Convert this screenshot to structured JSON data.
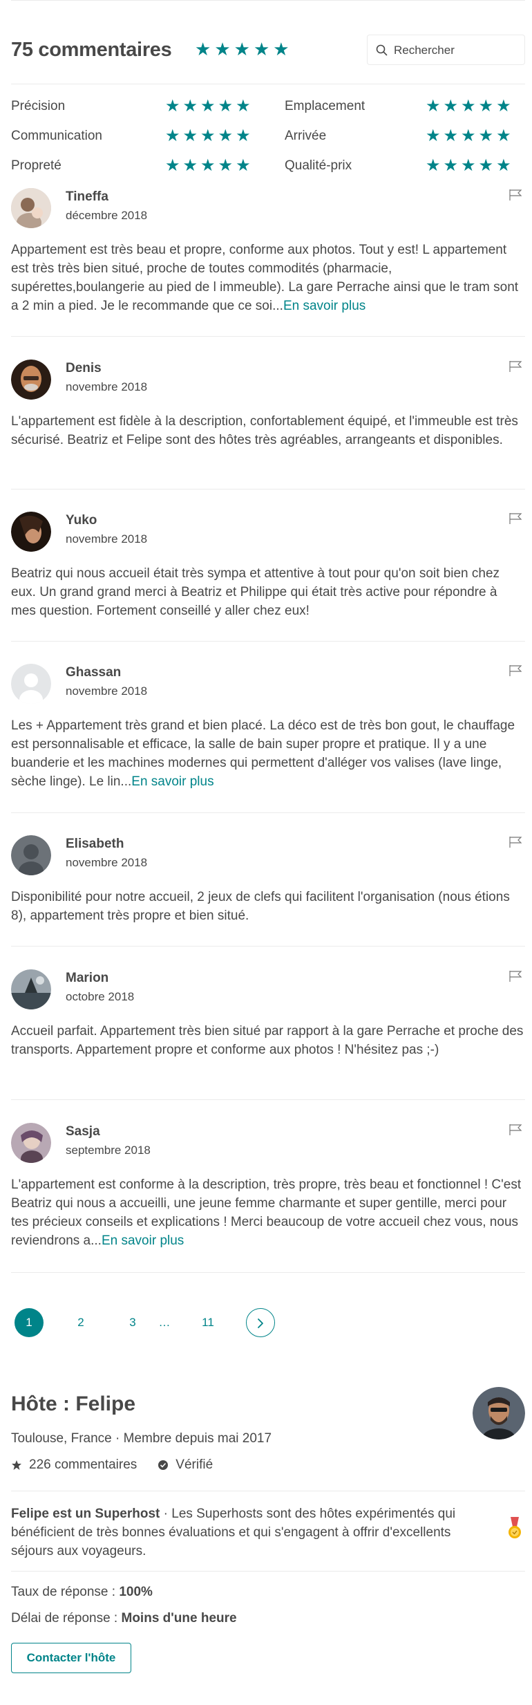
{
  "reviews_header": {
    "title": "75 commentaires",
    "overall_rating": 5,
    "search_placeholder": "Rechercher"
  },
  "categories": [
    {
      "label": "Précision",
      "rating": 5
    },
    {
      "label": "Emplacement",
      "rating": 5
    },
    {
      "label": "Communication",
      "rating": 5
    },
    {
      "label": "Arrivée",
      "rating": 5
    },
    {
      "label": "Propreté",
      "rating": 5
    },
    {
      "label": "Qualité-prix",
      "rating": 5
    }
  ],
  "reviews": [
    {
      "name": "Tineffa",
      "date": "décembre 2018",
      "text": "Appartement est très beau et propre, conforme aux photos. Tout y est! L appartement est très très bien situé, proche de toutes commodités (pharmacie, supérettes,boulangerie au pied de l immeuble). La gare Perrache ainsi que le tram sont a 2 min a pied. Je le recommande que ce soi...",
      "more": "En savoir plus"
    },
    {
      "name": "Denis",
      "date": "novembre 2018",
      "text": "L'appartement est fidèle à la description, confortablement équipé, et l'immeuble est très sécurisé. Beatriz et Felipe sont des hôtes très agréables, arrangeants et disponibles.",
      "more": ""
    },
    {
      "name": "Yuko",
      "date": "novembre 2018",
      "text": "Beatriz qui nous accueil était très sympa et attentive à tout pour qu'on soit bien chez eux. Un grand grand merci à Beatriz et Philippe qui était très active pour répondre à mes question. Fortement conseillé y aller chez eux!",
      "more": ""
    },
    {
      "name": "Ghassan",
      "date": "novembre 2018",
      "text": "Les + Appartement très grand et bien placé. La déco est de très bon gout, le chauffage est personnalisable et efficace, la salle de bain super propre et pratique. Il y a une buanderie et les machines modernes qui permettent d'alléger vos valises (lave linge, sèche linge). Le lin...",
      "more": "En savoir plus"
    },
    {
      "name": "Elisabeth",
      "date": "novembre 2018",
      "text": "Disponibilité pour notre accueil, 2 jeux de clefs qui facilitent l'organisation (nous étions 8), appartement très propre et bien situé.",
      "more": ""
    },
    {
      "name": "Marion",
      "date": "octobre 2018",
      "text": "Accueil parfait. Appartement très bien situé par rapport à la gare Perrache et proche des transports. Appartement propre et conforme aux photos ! N'hésitez pas ;-)",
      "more": ""
    },
    {
      "name": "Sasja",
      "date": "septembre 2018",
      "text": "L'appartement est conforme à la description, très propre, très beau et fonctionnel ! C'est Beatriz qui nous a accueilli, une jeune femme charmante et super gentille, merci pour tes précieux conseils et explications ! Merci beaucoup de votre accueil chez vous, nous reviendrons a...",
      "more": "En savoir plus"
    }
  ],
  "pagination": {
    "pages": [
      "1",
      "2",
      "3",
      "…",
      "11"
    ],
    "current": "1"
  },
  "host": {
    "title": "Hôte : Felipe",
    "subtitle": "Toulouse, France · Membre depuis mai 2017",
    "reviews_count": "226 commentaires",
    "verified": "Vérifié",
    "superhost_bold": "Felipe est un Superhost",
    "superhost_text": " · Les Superhosts sont des hôtes expérimentés qui bénéficient de très bonnes évaluations et qui s'engagent à offrir d'excellents séjours aux voyageurs.",
    "response_rate_label": "Taux de réponse : ",
    "response_rate_value": "100%",
    "response_time_label": "Délai de réponse : ",
    "response_time_value": "Moins d'une heure",
    "contact_label": "Contacter l'hôte"
  },
  "colors": {
    "accent": "#008489",
    "text": "#484848",
    "divider": "#ebebeb"
  }
}
